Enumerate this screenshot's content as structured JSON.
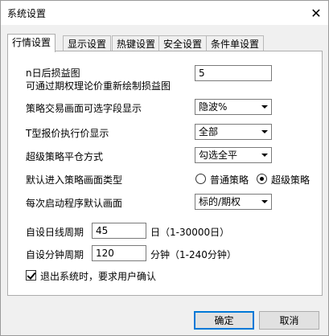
{
  "window": {
    "title": "系统设置",
    "close_glyph": "✕"
  },
  "tabs": [
    {
      "label": "行情设置",
      "active": true
    },
    {
      "label": "显示设置",
      "active": false
    },
    {
      "label": "热键设置",
      "active": false
    },
    {
      "label": "安全设置",
      "active": false
    },
    {
      "label": "条件单设置",
      "active": false
    }
  ],
  "settings": {
    "profit_loss_days_label_1": "n日后损益图",
    "profit_loss_days_label_2": "可通过期权理论价重新绘制损益图",
    "profit_loss_days_value": "5",
    "strategy_field_label": "策略交易画面可选字段显示",
    "strategy_field_value": "隐波%",
    "t_quote_label": "T型报价执行价显示",
    "t_quote_value": "全部",
    "super_close_label": "超级策略平仓方式",
    "super_close_value": "勾选全平",
    "default_strategy_label": "默认进入策略画面类型",
    "default_strategy_options": [
      "普通策略",
      "超级策略"
    ],
    "default_strategy_selected": "超级策略",
    "startup_label": "每次启动程序默认画面",
    "startup_value": "标的/期权",
    "daily_period_label": "自设日线周期",
    "daily_period_value": "45",
    "daily_period_hint": "日（1-30000日）",
    "minute_period_label": "自设分钟周期",
    "minute_period_value": "120",
    "minute_period_hint": "分钟（1-240分钟）",
    "confirm_exit_label": "退出系统时，要求用户确认",
    "confirm_exit_checked": true
  },
  "buttons": {
    "ok": "确定",
    "cancel": "取消"
  }
}
